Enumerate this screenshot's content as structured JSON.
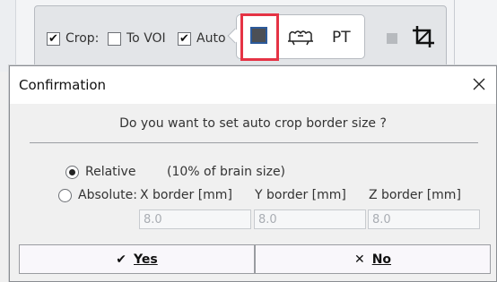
{
  "toolbar": {
    "crop_label": "Crop:",
    "to_voi_label": "To VOI",
    "auto_label": "Auto",
    "crop_checked": true,
    "to_voi_checked": false,
    "auto_checked": true,
    "mode_pt_label": "PT"
  },
  "dialog": {
    "title": "Confirmation",
    "question": "Do you want to set auto crop border size ?",
    "relative_label": "Relative",
    "relative_note": "(10% of brain size)",
    "absolute_label": "Absolute:",
    "x_border_label": "X border [mm]",
    "y_border_label": "Y border [mm]",
    "z_border_label": "Z border [mm]",
    "x_border_value": "8.0",
    "y_border_value": "8.0",
    "z_border_value": "8.0",
    "selected_option": "Relative",
    "yes_label": "Yes",
    "no_label": "No"
  },
  "icons": {
    "crop_mode_square": "square-mode-icon",
    "brain_mode": "head-outline-icon",
    "crop": "crop-icon",
    "close": "close-icon",
    "yes": "checkmark-icon",
    "no": "x-icon"
  },
  "colors": {
    "highlight": "#e53345",
    "panel": "#e3e5e8",
    "dialog_bg": "#f0f0f0"
  }
}
